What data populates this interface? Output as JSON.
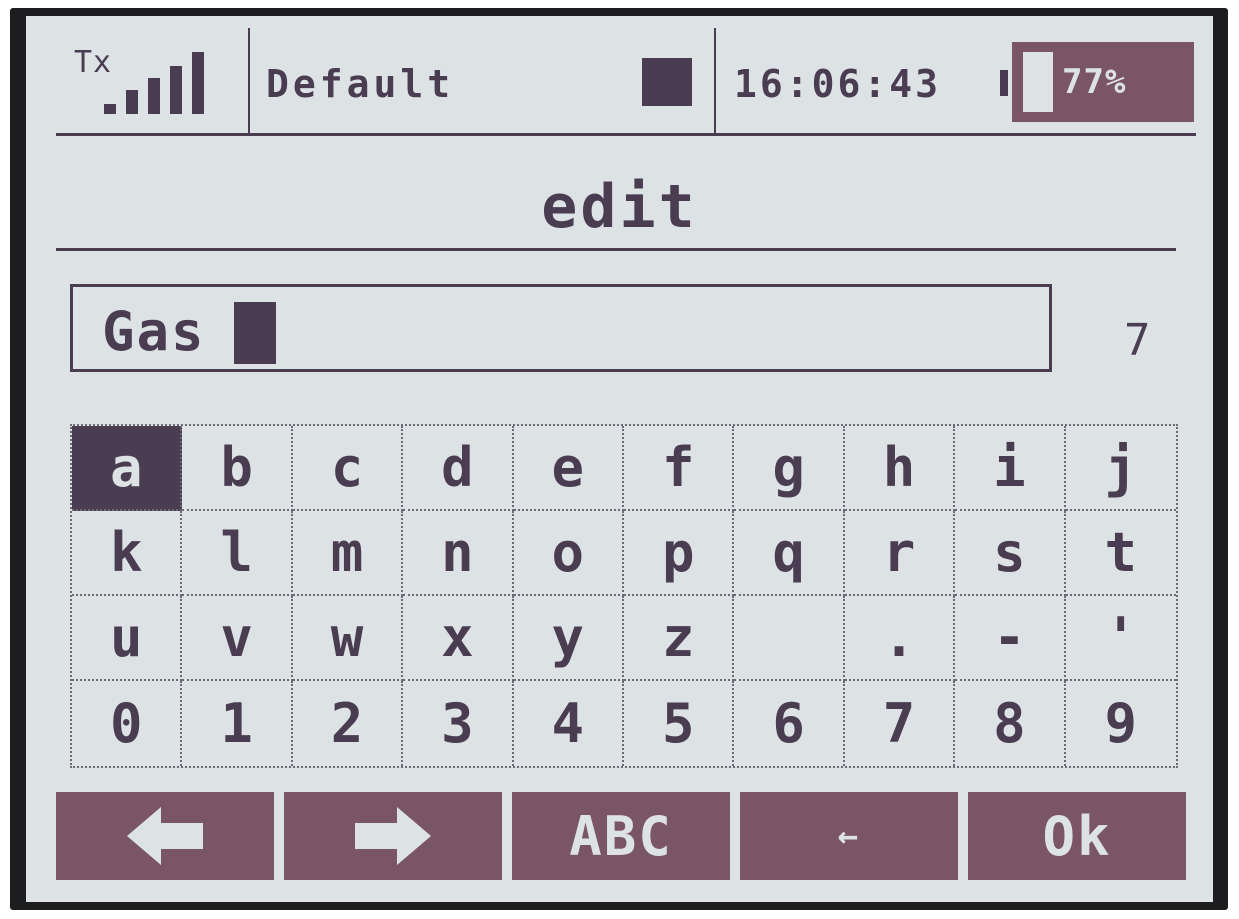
{
  "header": {
    "tx_label": "Tx",
    "model_name": "Default",
    "clock": "16:06:43",
    "battery_percent_label": "77%",
    "battery_level": 0.77,
    "signal_bars": 5
  },
  "screen_title": "edit",
  "editor": {
    "value": "Gas",
    "remaining_chars": "7"
  },
  "keyboard": {
    "selected_key": "a",
    "rows": [
      [
        "a",
        "b",
        "c",
        "d",
        "e",
        "f",
        "g",
        "h",
        "i",
        "j"
      ],
      [
        "k",
        "l",
        "m",
        "n",
        "o",
        "p",
        "q",
        "r",
        "s",
        "t"
      ],
      [
        "u",
        "v",
        "w",
        "x",
        "y",
        "z",
        " ",
        ".",
        "-",
        "'"
      ],
      [
        "0",
        "1",
        "2",
        "3",
        "4",
        "5",
        "6",
        "7",
        "8",
        "9"
      ]
    ]
  },
  "buttons": {
    "left_icon": "arrow-left-icon",
    "right_icon": "arrow-right-icon",
    "case_label": "ABC",
    "backspace_label": "←",
    "ok_label": "Ok"
  },
  "colors": {
    "lcd_background": "#dde2e4",
    "ink": "#4a3d52",
    "button_fill": "#7a5563"
  }
}
